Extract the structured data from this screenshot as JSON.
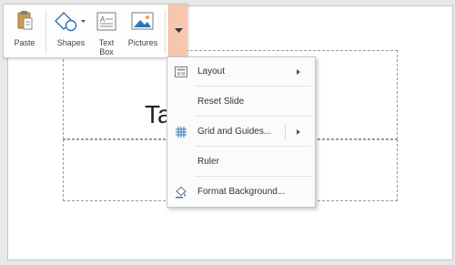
{
  "toolbar": {
    "buttons": [
      {
        "label": "Paste",
        "icon": "clipboard-icon"
      },
      {
        "label": "Shapes",
        "icon": "shapes-icon"
      },
      {
        "label": "Text\nBox",
        "icon": "text-box-icon"
      },
      {
        "label": "Pictures",
        "icon": "pictures-icon"
      }
    ],
    "more_icon": "chevron-down-icon",
    "more_highlight": "#f6c7ad"
  },
  "slide": {
    "title_text": "Ta"
  },
  "context_menu": {
    "items": [
      {
        "label": "Layout",
        "icon": "layout-icon",
        "submenu": true
      },
      {
        "label": "Reset Slide",
        "icon": null,
        "submenu": false
      },
      {
        "label": "Grid and Guides...",
        "icon": "grid-icon",
        "submenu": true
      },
      {
        "label": "Ruler",
        "icon": null,
        "submenu": false
      },
      {
        "label": "Format Background...",
        "icon": "format-background-icon",
        "submenu": false
      }
    ]
  }
}
